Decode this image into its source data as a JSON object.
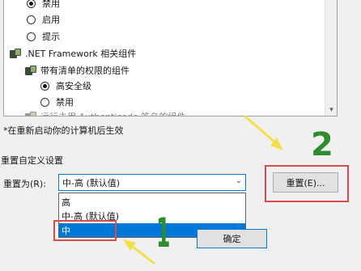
{
  "security_list": {
    "items": [
      {
        "type": "radio",
        "label": "禁用",
        "checked": true
      },
      {
        "type": "radio",
        "label": "启用",
        "checked": false
      },
      {
        "type": "radio",
        "label": "提示",
        "checked": false
      },
      {
        "type": "group",
        "label": ".NET Framework 相关组件"
      },
      {
        "type": "group",
        "label": "带有清单的权限的组件"
      },
      {
        "type": "radio",
        "label": "高安全级",
        "checked": true
      },
      {
        "type": "radio",
        "label": "禁用",
        "checked": false
      },
      {
        "type": "group",
        "label": "运行未用 Authenticode 签名的组件"
      }
    ]
  },
  "restart_note": "*在重新启动你的计算机后生效",
  "reset_section": {
    "title": "重置自定义设置",
    "reset_to_label": "重置为(R):",
    "combo_value": "中-高 (默认值)",
    "options": [
      {
        "label": "高",
        "selected": false
      },
      {
        "label": "中-高 (默认值)",
        "selected": false
      },
      {
        "label": "中",
        "selected": true
      }
    ],
    "reset_button": "重置(E)...",
    "ok_button": "确定"
  },
  "annotations": {
    "step_1": "1",
    "step_2": "2",
    "highlight_color": "#d94a4a",
    "arrow_color": "#f2e04a",
    "number_color": "#2e8b2e"
  },
  "colors": {
    "selection": "#0078d7",
    "dialog_bg": "#f0f0f0"
  }
}
